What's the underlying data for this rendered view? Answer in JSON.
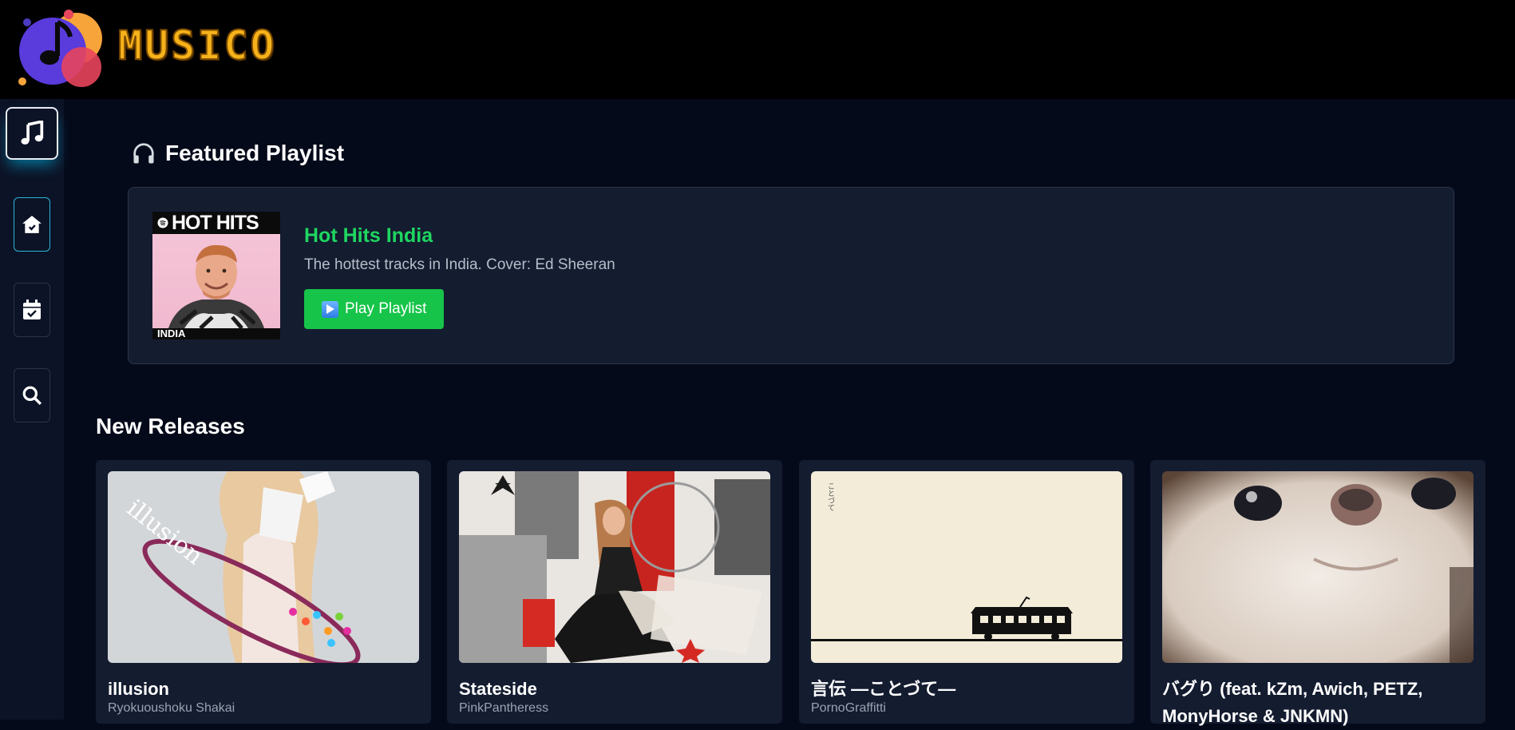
{
  "app": {
    "brand_name": "MUSICO",
    "brand_color": "#f6b21a"
  },
  "sidebar": {
    "items": [
      {
        "icon": "music-note-icon",
        "active": true
      },
      {
        "icon": "home-icon",
        "active": false
      },
      {
        "icon": "calendar-check-icon",
        "active": false
      },
      {
        "icon": "search-icon",
        "active": false
      }
    ]
  },
  "featured": {
    "heading": "Featured Playlist",
    "heading_icon": "headphones-icon",
    "playlist": {
      "cover_top_text": "HOT HITS",
      "cover_bottom_text": "INDIA",
      "title": "Hot Hits India",
      "description": "The hottest tracks in India. Cover: Ed Sheeran",
      "play_label": "Play Playlist"
    },
    "accent_color": "#1ed760"
  },
  "new_releases": {
    "heading": "New Releases",
    "items": [
      {
        "title": "illusion",
        "artist": "Ryokuoushoku Shakai",
        "art_text": "illusion"
      },
      {
        "title": "Stateside",
        "artist": "PinkPantheress"
      },
      {
        "title": "言伝 —ことづて—",
        "artist": "PornoGraffitti",
        "art_text": "ことづて"
      },
      {
        "title": "バグり (feat. kZm, Awich, PETZ, MonyHorse & JNKMN)",
        "artist": ""
      }
    ]
  }
}
